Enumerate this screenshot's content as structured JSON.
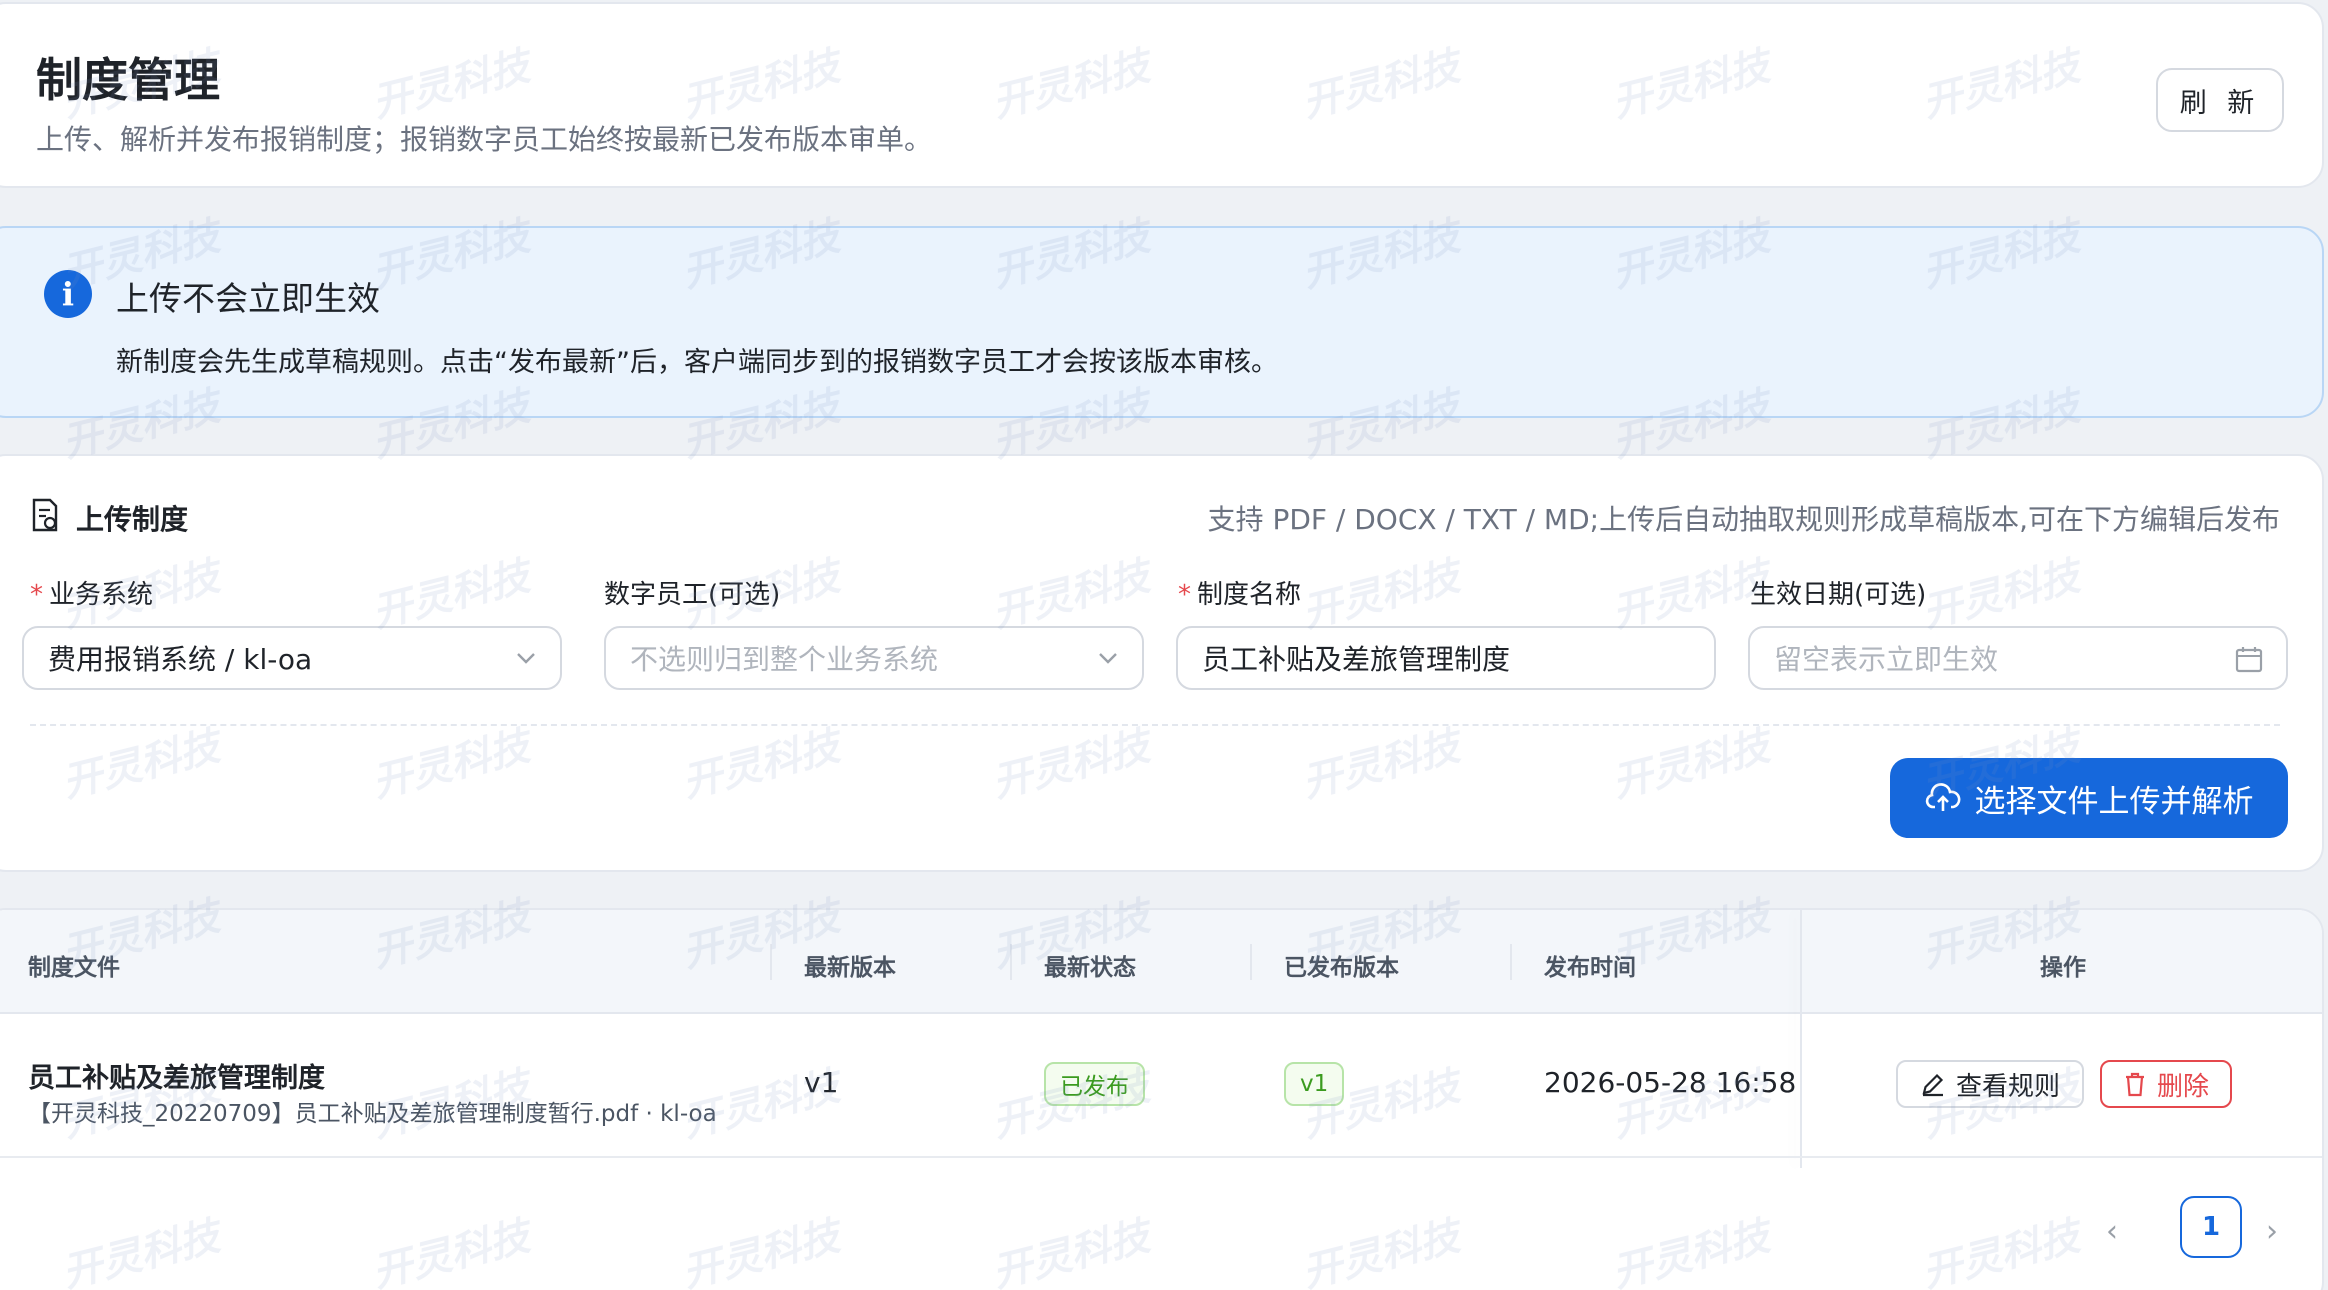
{
  "header": {
    "title": "制度管理",
    "subtitle": "上传、解析并发布报销制度；报销数字员工始终按最新已发布版本审单。",
    "refresh_label": "刷 新"
  },
  "alert": {
    "icon": "info-icon",
    "title": "上传不会立即生效",
    "description": "新制度会先生成草稿规则。点击“发布最新”后，客户端同步到的报销数字员工才会按该版本审核。"
  },
  "upload": {
    "title": "上传制度",
    "hint": "支持 PDF / DOCX / TXT / MD;上传后自动抽取规则形成草稿版本,可在下方编辑后发布",
    "fields": [
      {
        "label": "业务系统",
        "required": true,
        "value": "费用报销系统 / kl-oa",
        "placeholder": ""
      },
      {
        "label": "数字员工(可选)",
        "required": false,
        "value": "",
        "placeholder": "不选则归到整个业务系统"
      },
      {
        "label": "制度名称",
        "required": true,
        "value": "员工补贴及差旅管理制度",
        "placeholder": ""
      },
      {
        "label": "生效日期(可选)",
        "required": false,
        "value": "",
        "placeholder": "留空表示立即生效"
      }
    ],
    "upload_button": "选择文件上传并解析"
  },
  "table": {
    "columns": [
      "制度文件",
      "最新版本",
      "最新状态",
      "已发布版本",
      "发布时间",
      "操作"
    ],
    "rows": [
      {
        "file_name": "员工补贴及差旅管理制度",
        "file_sub": "【开灵科技_20220709】员工补贴及差旅管理制度暂行.pdf · kl-oa",
        "latest_version": "v1",
        "status": "已发布",
        "published_version": "v1",
        "published_time": "2026-05-28 16:58",
        "view_label": "查看规则",
        "delete_label": "删除"
      }
    ]
  },
  "pagination": {
    "current": "1",
    "prev": "‹",
    "next": "›"
  },
  "watermark": {
    "text": "开灵科技"
  },
  "colors": {
    "primary": "#1668dc",
    "danger": "#e5484d",
    "success": "#3b9b1f",
    "alert_bg": "#eaf3fd"
  }
}
